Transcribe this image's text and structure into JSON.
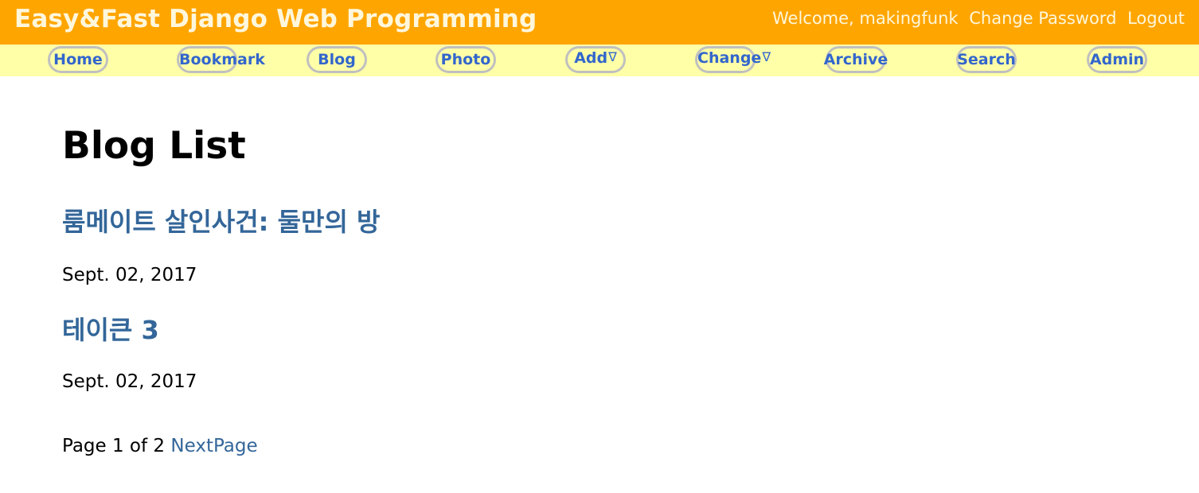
{
  "header": {
    "site_title": "Easy&Fast Django Web Programming",
    "welcome": "Welcome, makingfunk",
    "change_password": "Change Password",
    "logout": "Logout"
  },
  "menu": {
    "home": "Home",
    "bookmark": "Bookmark",
    "blog": "Blog",
    "photo": "Photo",
    "add": "Add",
    "change": "Change",
    "archive": "Archive",
    "search": "Search",
    "admin": "Admin",
    "dropdown_glyph": "∇"
  },
  "main": {
    "page_title": "Blog List",
    "posts": [
      {
        "title": "룸메이트 살인사건: 둘만의 방",
        "date": "Sept. 02, 2017"
      },
      {
        "title": "테이큰 3",
        "date": "Sept. 02, 2017"
      }
    ],
    "pager": {
      "page_text": "Page 1 of 2",
      "next_label": "NextPage"
    }
  },
  "colors": {
    "header_bg": "#ffa500",
    "menu_bg": "#ffffa8",
    "menu_link": "#3366cc",
    "post_link": "#336699"
  }
}
